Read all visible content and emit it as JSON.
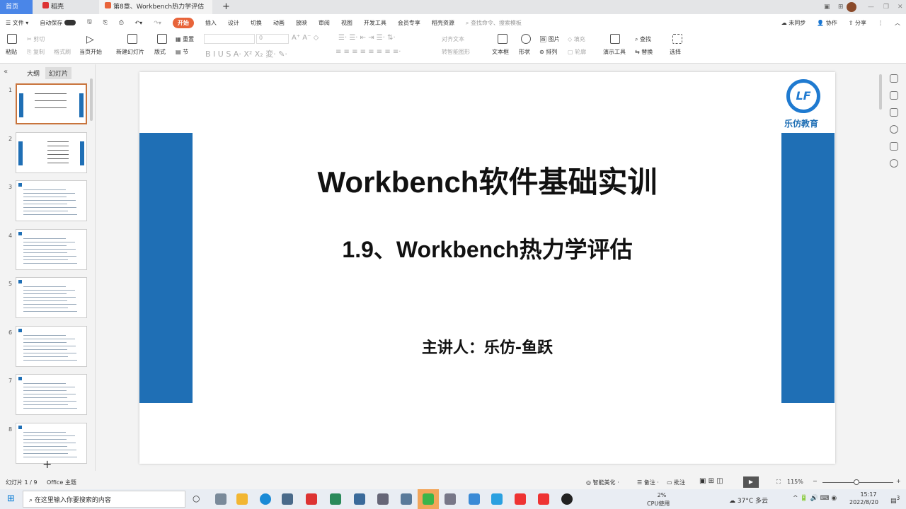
{
  "tabs": [
    {
      "label": "首页"
    },
    {
      "label": "稻壳"
    },
    {
      "label": "第8章、Workbench热力学评估"
    }
  ],
  "window": {
    "new_tab": "+"
  },
  "menu": {
    "file": "文件",
    "autosave": "自动保存",
    "items": [
      "开始",
      "插入",
      "设计",
      "切换",
      "动画",
      "放映",
      "审阅",
      "视图",
      "开发工具",
      "会员专享",
      "稻壳资源"
    ],
    "search_placeholder": "查找命令、搜索模板",
    "unsync": "未同步",
    "collab": "协作",
    "share": "分享"
  },
  "toolbar": {
    "paste": "粘贴",
    "cut": "剪切",
    "copy": "复制",
    "format_painter": "格式刷",
    "play_from_current": "当页开始",
    "new_slide": "新建幻灯片",
    "layout": "版式",
    "reset": "重置",
    "section": "节",
    "font_size": "0",
    "align_text": "对齐文本",
    "smartart": "转智能图形",
    "textbox": "文本框",
    "shape": "形状",
    "picture": "图片",
    "fill": "填充",
    "arrange": "排列",
    "outline": "轮廓",
    "presentation_tools": "演示工具",
    "find": "查找",
    "replace": "替换",
    "select": "选择"
  },
  "left_panel": {
    "outline_tab": "大纲",
    "slides_tab": "幻灯片",
    "add": "+",
    "slide_numbers": [
      "1",
      "2",
      "3",
      "4",
      "5",
      "6",
      "7",
      "8"
    ]
  },
  "slide": {
    "title": "Workbench软件基础实训",
    "subtitle": "1.9、Workbench热力学评估",
    "presenter": "主讲人：乐仿-鱼跃",
    "logo_text": "乐仿教育",
    "logo_mark": "LF"
  },
  "statusbar": {
    "slide_count": "幻灯片 1 / 9",
    "theme": "Office 主题",
    "beautify": "智能美化",
    "notes": "备注",
    "comments": "批注",
    "zoom": "115%"
  },
  "taskbar": {
    "search_placeholder": "在这里输入你要搜索的内容",
    "cpu_percent": "2%",
    "cpu_label": "CPU使用",
    "weather": "37°C 多云",
    "time": "15:17",
    "date": "2022/8/20",
    "notif": "3"
  },
  "colors": {
    "accent": "#e8643a",
    "slide_blue": "#1f6fb5",
    "home_tab": "#4a86e8"
  }
}
